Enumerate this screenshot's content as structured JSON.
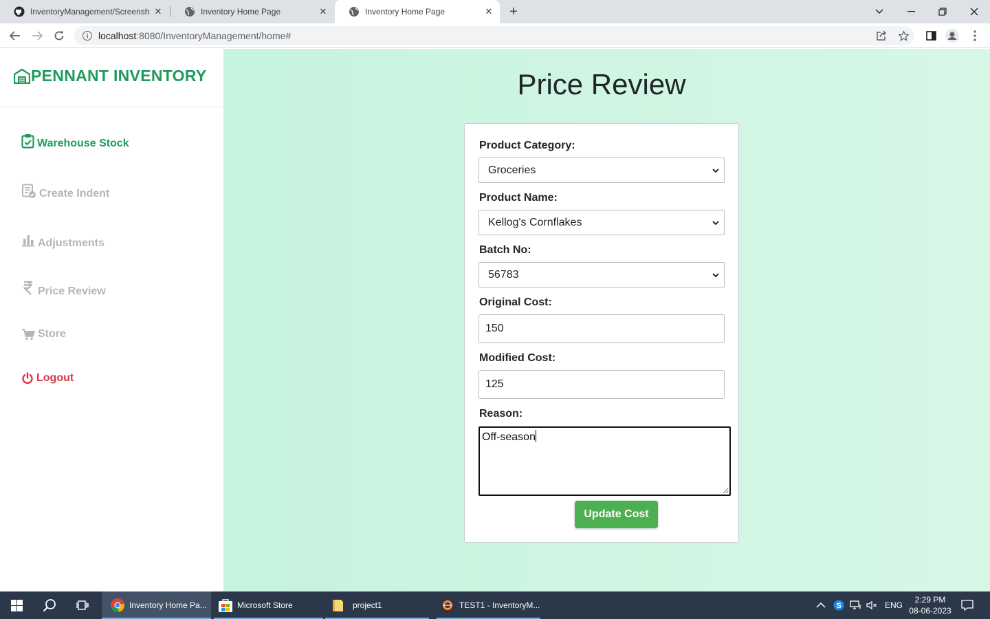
{
  "browser": {
    "tabs": [
      {
        "title": "InventoryManagement/Screensh",
        "icon": "github-icon"
      },
      {
        "title": "Inventory Home Page",
        "icon": "globe-icon"
      },
      {
        "title": "Inventory Home Page",
        "icon": "globe-icon",
        "active": true
      }
    ],
    "url_host": "localhost",
    "url_rest": ":8080/InventoryManagement/home#"
  },
  "sidebar": {
    "brand": "PENNANT INVENTORY",
    "items": [
      {
        "label": "Warehouse Stock",
        "icon": "clipboard-check-icon",
        "active": true
      },
      {
        "label": "Create Indent",
        "icon": "file-check-icon"
      },
      {
        "label": "Adjustments",
        "icon": "bar-chart-icon"
      },
      {
        "label": "Price Review",
        "icon": "rupee-icon"
      },
      {
        "label": "Store",
        "icon": "cart-icon"
      },
      {
        "label": "Logout",
        "icon": "power-icon"
      }
    ]
  },
  "main": {
    "title": "Price Review",
    "form": {
      "category_label": "Product Category:",
      "category_value": "Groceries",
      "product_label": "Product Name:",
      "product_value": "Kellog's Cornflakes",
      "batch_label": "Batch No:",
      "batch_value": "56783",
      "original_label": "Original Cost:",
      "original_value": "150",
      "modified_label": "Modified Cost:",
      "modified_value": "125",
      "reason_label": "Reason:",
      "reason_value": "Off-season",
      "submit_label": "Update Cost"
    }
  },
  "taskbar": {
    "items": [
      {
        "label": "Inventory Home Pa...",
        "icon": "chrome-icon"
      },
      {
        "label": "Microsoft Store",
        "icon": "store-icon"
      },
      {
        "label": "project1",
        "icon": "folder-icon"
      },
      {
        "label": "TEST1 - InventoryM...",
        "icon": "eclipse-icon"
      }
    ],
    "language": "ENG",
    "time": "2:29 PM",
    "date": "08-06-2023"
  },
  "colors": {
    "brand_green": "#1e9b5b",
    "button_green": "#4caf50",
    "logout_red": "#dc3545",
    "main_bg": "#c6f4de"
  }
}
